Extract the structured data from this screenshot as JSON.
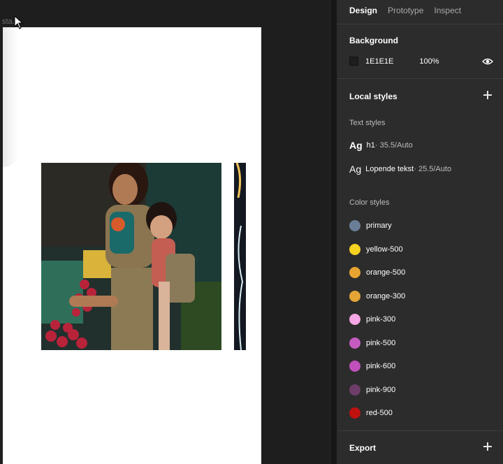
{
  "canvas": {
    "frame_label": "sta..."
  },
  "panel": {
    "tabs": [
      {
        "label": "Design"
      },
      {
        "label": "Prototype"
      },
      {
        "label": "Inspect"
      }
    ],
    "background": {
      "title": "Background",
      "hex": "1E1E1E",
      "opacity": "100%",
      "swatch_color": "#1E1E1E"
    },
    "local_styles": {
      "title": "Local styles"
    },
    "text_styles": {
      "title": "Text styles",
      "items": [
        {
          "glyph": "Ag",
          "name": "h1",
          "spec": " · 35.5/Auto"
        },
        {
          "glyph": "Ag",
          "name": "Lopende tekst",
          "spec": " · 25.5/Auto"
        }
      ]
    },
    "color_styles": {
      "title": "Color styles",
      "items": [
        {
          "name": "primary",
          "color": "#6B7E98"
        },
        {
          "name": "yellow-500",
          "color": "#F7D21E"
        },
        {
          "name": "orange-500",
          "color": "#E8A431"
        },
        {
          "name": "orange-300",
          "color": "#E3A536"
        },
        {
          "name": "pink-300",
          "color": "#F6A6E4"
        },
        {
          "name": "pink-500",
          "color": "#C55BC0"
        },
        {
          "name": "pink-600",
          "color": "#C050BB"
        },
        {
          "name": "pink-900",
          "color": "#6E3E6A"
        },
        {
          "name": "red-500",
          "color": "#C01111"
        }
      ]
    },
    "export": {
      "title": "Export"
    }
  }
}
